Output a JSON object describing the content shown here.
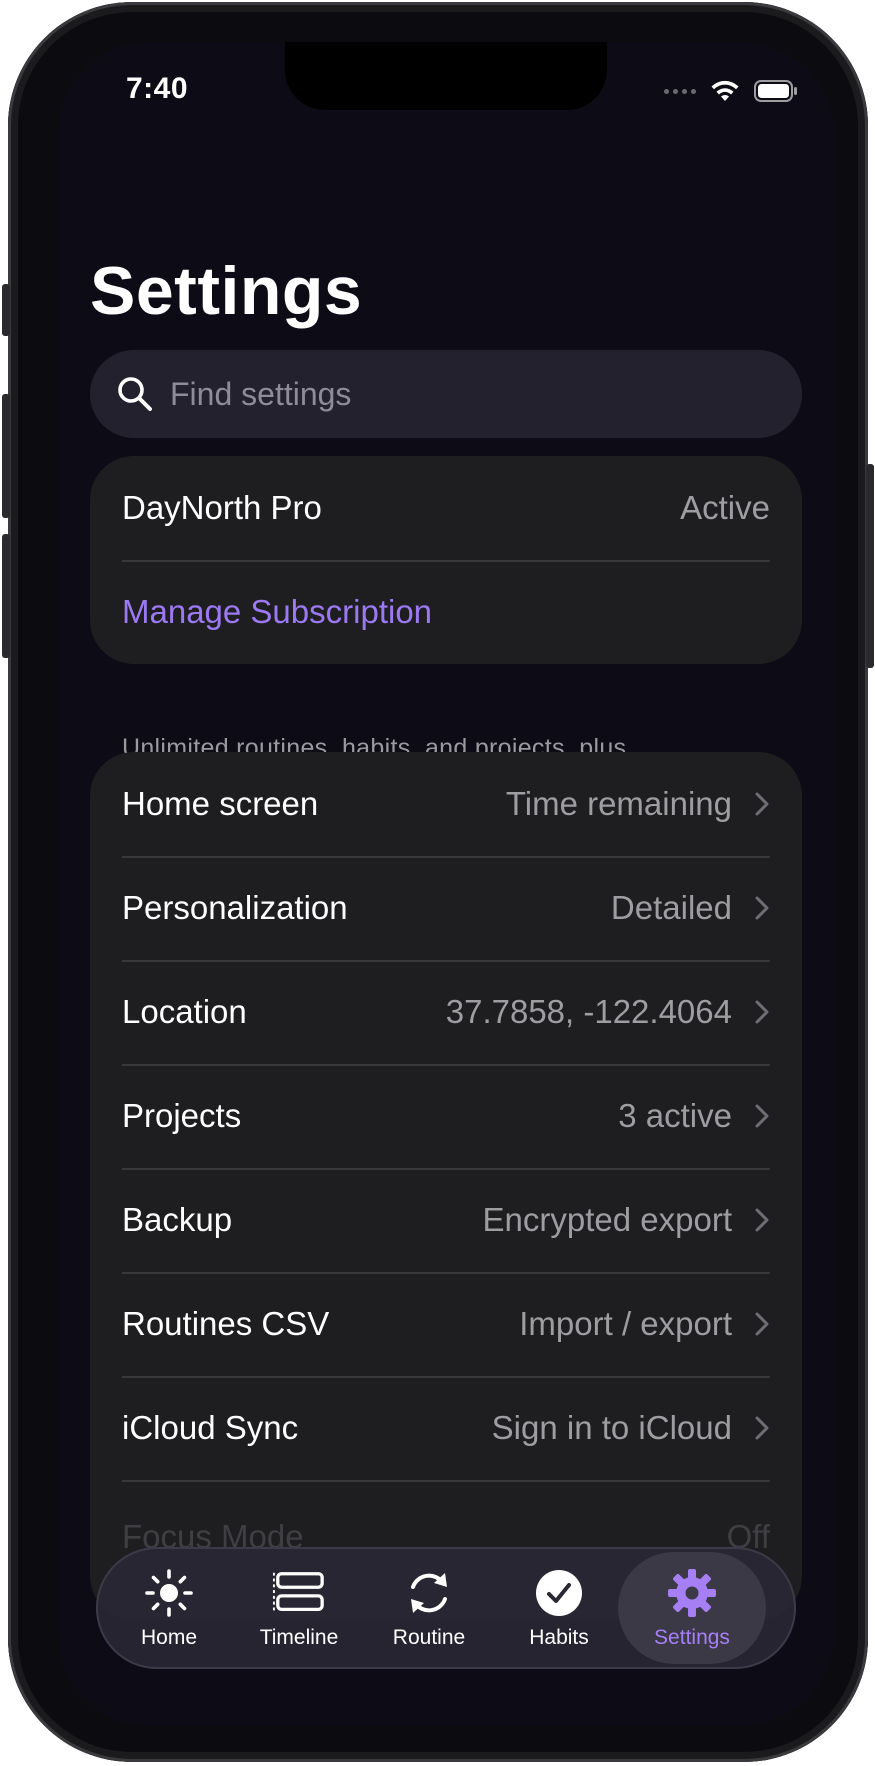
{
  "status": {
    "time": "7:40"
  },
  "page": {
    "title": "Settings"
  },
  "search": {
    "placeholder": "Find settings",
    "icon": "magnifying-glass-icon"
  },
  "subscription": {
    "product": "DayNorth Pro",
    "status": "Active",
    "manage_label": "Manage Subscription",
    "footnote": "Unlimited routines, habits, and projects, plus Focus Mode."
  },
  "settings_rows": [
    {
      "label": "Home screen",
      "value": "Time remaining"
    },
    {
      "label": "Personalization",
      "value": "Detailed"
    },
    {
      "label": "Location",
      "value": "37.7858, -122.4064"
    },
    {
      "label": "Projects",
      "value": "3 active"
    },
    {
      "label": "Backup",
      "value": "Encrypted export"
    },
    {
      "label": "Routines CSV",
      "value": "Import / export"
    },
    {
      "label": "iCloud Sync",
      "value": "Sign in to iCloud"
    }
  ],
  "hidden_rows": [
    {
      "label": "Focus Mode",
      "value": "Off"
    }
  ],
  "tabbar": {
    "tabs": [
      {
        "label": "Home",
        "icon": "sun-icon"
      },
      {
        "label": "Timeline",
        "icon": "timeline-icon"
      },
      {
        "label": "Routine",
        "icon": "refresh-icon"
      },
      {
        "label": "Habits",
        "icon": "checkmark-circle-icon"
      },
      {
        "label": "Settings",
        "icon": "gear-icon"
      }
    ],
    "active": "Settings"
  },
  "colors": {
    "accent": "#9b79f2",
    "background": "#0d0c16",
    "card": "#1e1e20"
  }
}
